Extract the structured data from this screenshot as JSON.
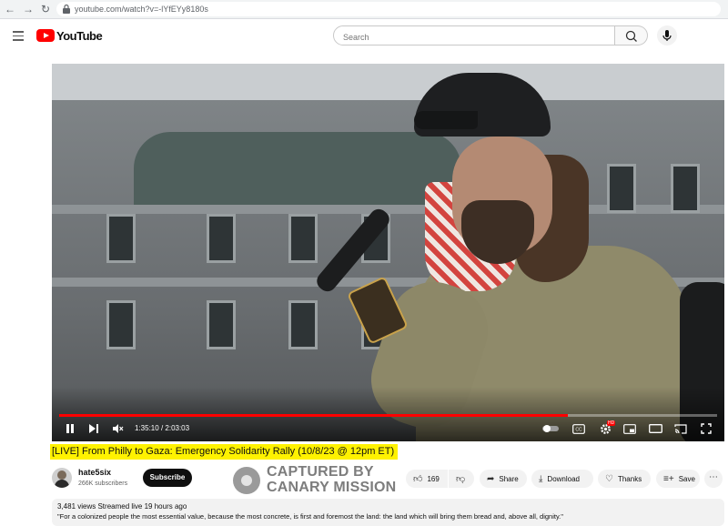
{
  "browser": {
    "url": "youtube.com/watch?v=-lYfEYy8180s",
    "back_icon": "back-arrow-icon",
    "forward_icon": "forward-arrow-icon",
    "reload_icon": "reload-icon",
    "lock_icon": "lock-icon"
  },
  "header": {
    "logo_text": "YouTube",
    "search_placeholder": "Search",
    "brand_color": "#ff0000"
  },
  "player": {
    "time_current": "1:35:10",
    "time_total": "2:03:03",
    "progress": 0.773,
    "hd_badge": "HD",
    "progress_color": "#ff0000"
  },
  "video": {
    "title": "[LIVE] From Philly to Gaza: Emergency Solidarity Rally (10/8/23 @ 12pm ET)",
    "title_highlight": "#fff200",
    "channel": "hate5six",
    "subscribers": "266K subscribers",
    "subscribe_label": "Subscribe",
    "likes": "169",
    "actions": {
      "share": "Share",
      "download": "Download",
      "thanks": "Thanks",
      "save": "Save"
    },
    "views_line": "3,481 views  Streamed live 19 hours ago",
    "description_line": "\"For a colonized people the most essential value, because the most concrete, is first and foremost the land: the land which will bring them bread and, above all, dignity.\""
  },
  "watermark": {
    "line1": "CAPTURED BY",
    "line2": "CANARY MISSION"
  }
}
